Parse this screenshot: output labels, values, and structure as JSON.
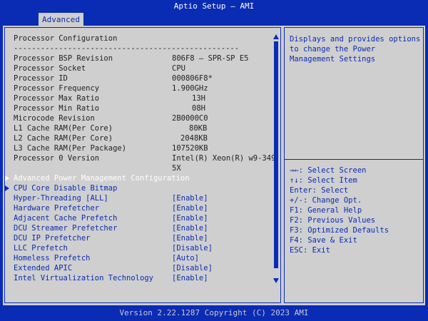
{
  "window": {
    "title": "Aptio Setup – AMI"
  },
  "tabs": [
    {
      "label": "Advanced"
    }
  ],
  "heading": "Processor Configuration",
  "separator": "--------------------------------------------------",
  "info_rows": [
    {
      "label": "Processor BSP Revision",
      "value": "806F8 – SPR-SP E5"
    },
    {
      "label": "Processor Socket",
      "value": "CPU"
    },
    {
      "label": "Processor ID",
      "value": "000806F8*"
    },
    {
      "label": "Processor Frequency",
      "value": "1.900GHz"
    },
    {
      "label": "Processor Max Ratio",
      "value": "13H"
    },
    {
      "label": "Processor Min Ratio",
      "value": "08H"
    },
    {
      "label": "Microcode Revision",
      "value": "2B0000C0"
    },
    {
      "label": "L1 Cache RAM(Per Core)",
      "value": "80KB"
    },
    {
      "label": "L2 Cache RAM(Per Core)",
      "value": "2048KB"
    },
    {
      "label": "L3 Cache RAM(Per Package)",
      "value": "107520KB"
    },
    {
      "label": "Processor 0 Version",
      "value": "Intel(R) Xeon(R) w9-349"
    },
    {
      "label": "",
      "value": "5X"
    }
  ],
  "submenus": [
    {
      "label": "Advanced Power Management Configuration"
    },
    {
      "label": "CPU Core Disable Bitmap"
    }
  ],
  "options": [
    {
      "label": "Hyper-Threading [ALL]",
      "value": "[Enable]"
    },
    {
      "label": "Hardware Prefetcher",
      "value": "[Enable]"
    },
    {
      "label": "Adjacent Cache Prefetch",
      "value": "[Enable]"
    },
    {
      "label": "DCU Streamer Prefetcher",
      "value": "[Enable]"
    },
    {
      "label": "DCU IP Prefetcher",
      "value": "[Enable]"
    },
    {
      "label": "LLC Prefetch",
      "value": "[Disable]"
    },
    {
      "label": "Homeless Prefetch",
      "value": "[Auto]"
    },
    {
      "label": "Extended APIC",
      "value": "[Disable]"
    },
    {
      "label": "Intel Virtualization Technology",
      "value": "[Enable]"
    }
  ],
  "help": {
    "description": "Displays and provides options to change the Power Management Settings",
    "keys": [
      "→←: Select Screen",
      "↑↓: Select Item",
      "Enter: Select",
      "+/-: Change Opt.",
      "F1: General Help",
      "F2: Previous Values",
      "F3: Optimized Defaults",
      "F4: Save & Exit",
      "ESC: Exit"
    ]
  },
  "footer": "Version 2.22.1287 Copyright (C) 2023 AMI",
  "colors": {
    "background": "#0a2bb4",
    "panel": "#cfcfcf",
    "highlight_text": "#ffffff"
  }
}
